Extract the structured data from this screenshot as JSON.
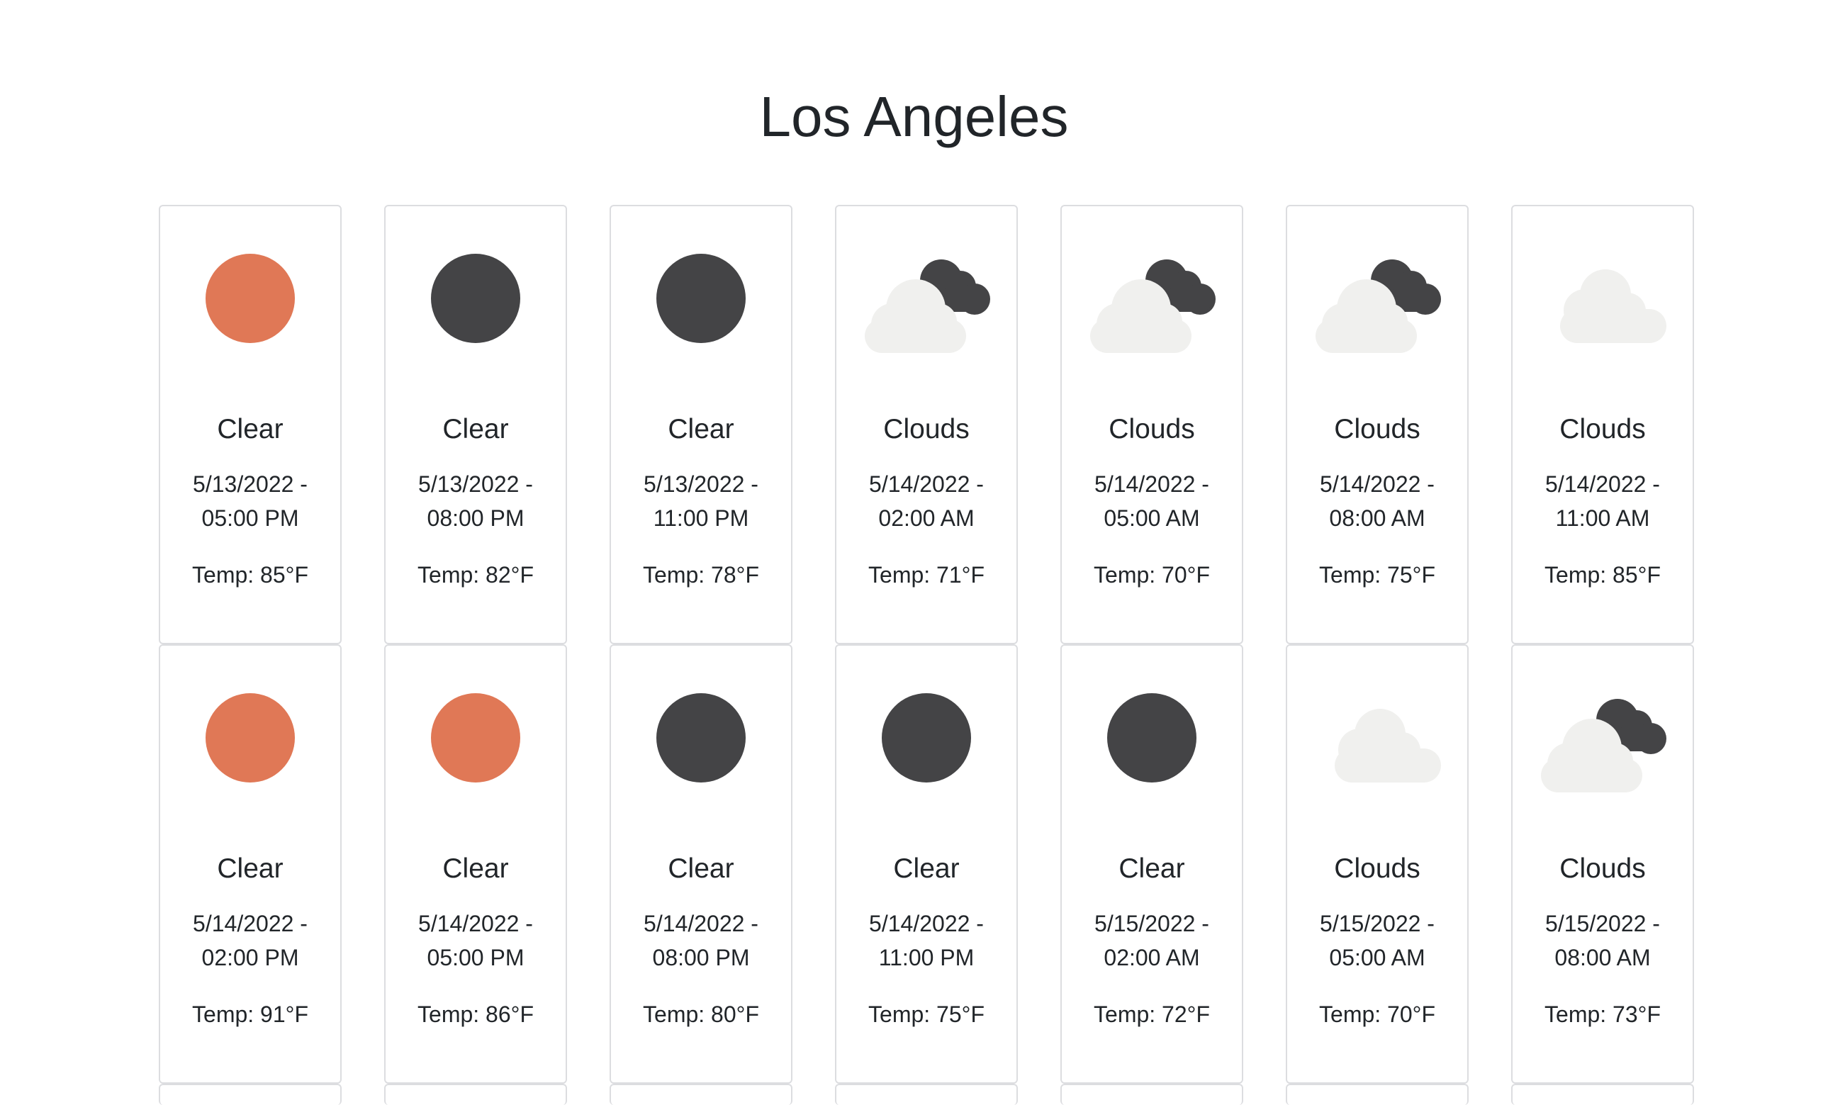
{
  "page": {
    "city": "Los Angeles"
  },
  "colors": {
    "sun": "#E07856",
    "moon": "#444446",
    "cloud": "#F0F0EE",
    "text": "#212529",
    "card_border": "#DCDDE0"
  },
  "forecast": [
    {
      "condition": "Clear",
      "date_line1": "5/13/2022 -",
      "date_line2": "05:00 PM",
      "temp": "Temp: 85°F",
      "icon": "sun-icon"
    },
    {
      "condition": "Clear",
      "date_line1": "5/13/2022 -",
      "date_line2": "08:00 PM",
      "temp": "Temp: 82°F",
      "icon": "moon-icon"
    },
    {
      "condition": "Clear",
      "date_line1": "5/13/2022 -",
      "date_line2": "11:00 PM",
      "temp": "Temp: 78°F",
      "icon": "moon-icon"
    },
    {
      "condition": "Clouds",
      "date_line1": "5/14/2022 -",
      "date_line2": "02:00 AM",
      "temp": "Temp: 71°F",
      "icon": "night-clouds-icon"
    },
    {
      "condition": "Clouds",
      "date_line1": "5/14/2022 -",
      "date_line2": "05:00 AM",
      "temp": "Temp: 70°F",
      "icon": "night-clouds-icon"
    },
    {
      "condition": "Clouds",
      "date_line1": "5/14/2022 -",
      "date_line2": "08:00 AM",
      "temp": "Temp: 75°F",
      "icon": "night-clouds-icon"
    },
    {
      "condition": "Clouds",
      "date_line1": "5/14/2022 -",
      "date_line2": "11:00 AM",
      "temp": "Temp: 85°F",
      "icon": "cloud-icon"
    },
    {
      "condition": "Clear",
      "date_line1": "5/14/2022 -",
      "date_line2": "02:00 PM",
      "temp": "Temp: 91°F",
      "icon": "sun-icon"
    },
    {
      "condition": "Clear",
      "date_line1": "5/14/2022 -",
      "date_line2": "05:00 PM",
      "temp": "Temp: 86°F",
      "icon": "sun-icon"
    },
    {
      "condition": "Clear",
      "date_line1": "5/14/2022 -",
      "date_line2": "08:00 PM",
      "temp": "Temp: 80°F",
      "icon": "moon-icon"
    },
    {
      "condition": "Clear",
      "date_line1": "5/14/2022 -",
      "date_line2": "11:00 PM",
      "temp": "Temp: 75°F",
      "icon": "moon-icon"
    },
    {
      "condition": "Clear",
      "date_line1": "5/15/2022 -",
      "date_line2": "02:00 AM",
      "temp": "Temp: 72°F",
      "icon": "moon-icon"
    },
    {
      "condition": "Clouds",
      "date_line1": "5/15/2022 -",
      "date_line2": "05:00 AM",
      "temp": "Temp: 70°F",
      "icon": "cloud-icon"
    },
    {
      "condition": "Clouds",
      "date_line1": "5/15/2022 -",
      "date_line2": "08:00 AM",
      "temp": "Temp: 73°F",
      "icon": "night-clouds-icon"
    }
  ]
}
